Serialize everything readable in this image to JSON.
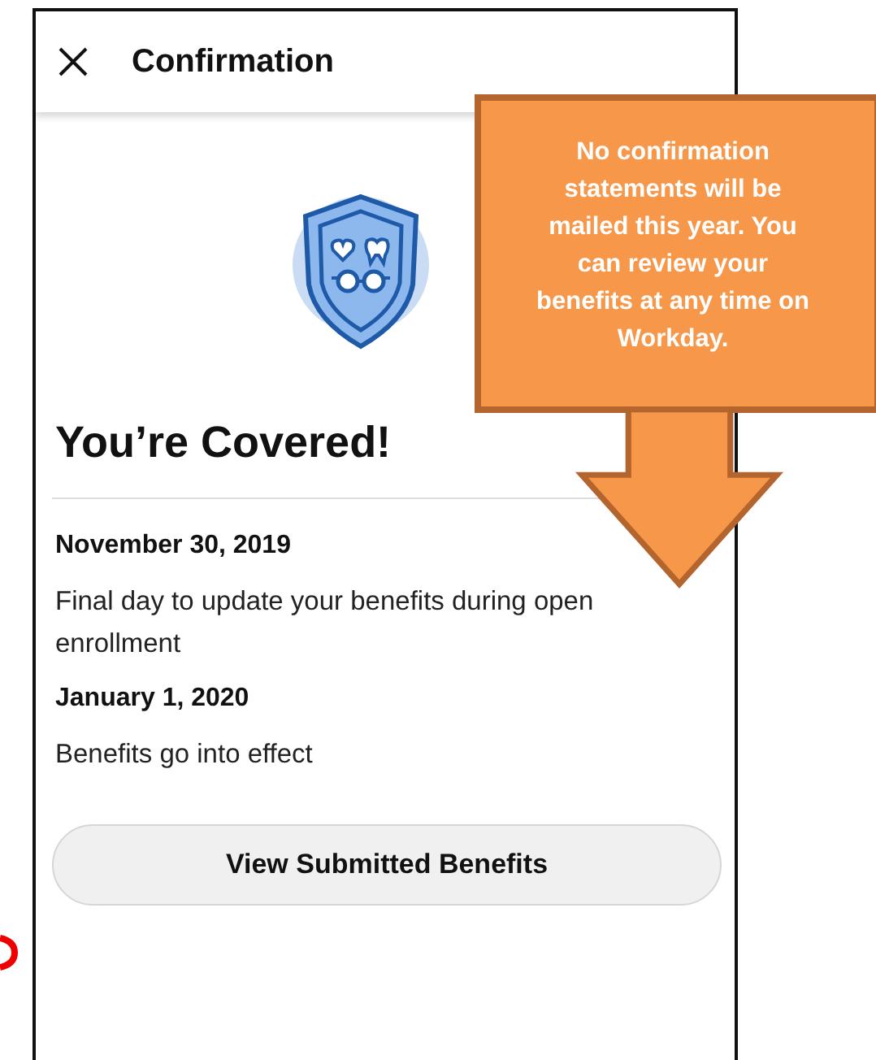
{
  "header": {
    "title": "Confirmation"
  },
  "heading": "You’re Covered!",
  "events": [
    {
      "date": "November 30, 2019",
      "description": "Final day to update your benefits during open enrollment"
    },
    {
      "date": "January 1, 2020",
      "description": "Benefits go into effect"
    }
  ],
  "button": {
    "label": "View Submitted Benefits"
  },
  "callout": {
    "text": "No confirmation statements will be mailed this year. You can review your benefits at any time on Workday."
  }
}
